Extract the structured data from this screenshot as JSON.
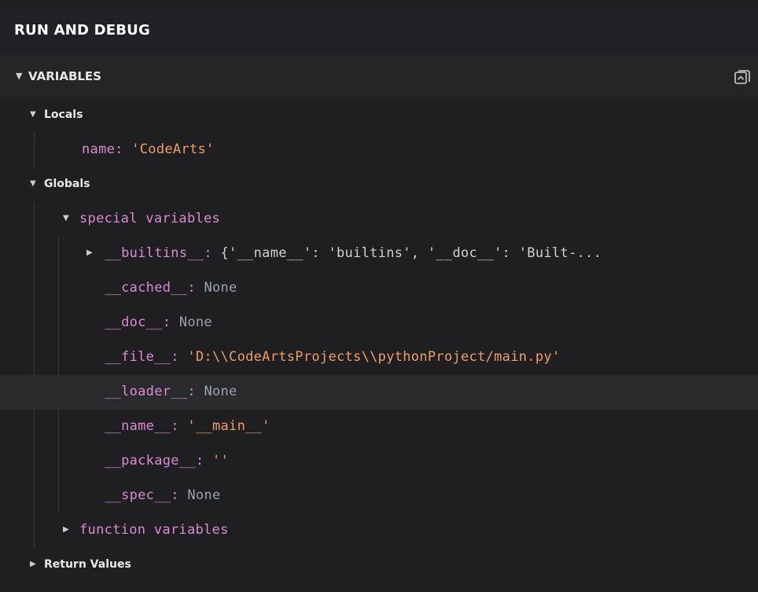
{
  "panel": {
    "title": "RUN AND DEBUG"
  },
  "section": {
    "arrow": "▼",
    "title": "VARIABLES"
  },
  "tree": {
    "locals": {
      "label": "Locals",
      "arrow": "▼",
      "items": [
        {
          "name": "name",
          "sep": ": ",
          "value": "'CodeArts'"
        }
      ]
    },
    "globals": {
      "label": "Globals",
      "arrow": "▼",
      "special": {
        "label": "special variables",
        "arrow": "▼",
        "items": [
          {
            "arrow": "▶",
            "name": "__builtins__",
            "sep": ": ",
            "value": "{'__name__': 'builtins', '__doc__': 'Built-..."
          },
          {
            "name": "__cached__",
            "sep": ": ",
            "value": "None"
          },
          {
            "name": "__doc__",
            "sep": ": ",
            "value": "None"
          },
          {
            "name": "__file__",
            "sep": ": ",
            "value": "'D:\\\\CodeArtsProjects\\\\pythonProject/main.py'"
          },
          {
            "name": "__loader__",
            "sep": ": ",
            "value": "None"
          },
          {
            "name": "__name__",
            "sep": ": ",
            "value": "'__main__'"
          },
          {
            "name": "__package__",
            "sep": ": ",
            "value": "''"
          },
          {
            "name": "__spec__",
            "sep": ": ",
            "value": "None"
          }
        ]
      },
      "function": {
        "label": "function variables",
        "arrow": "▶"
      }
    },
    "return_values": {
      "label": "Return Values",
      "arrow": "▶"
    }
  }
}
